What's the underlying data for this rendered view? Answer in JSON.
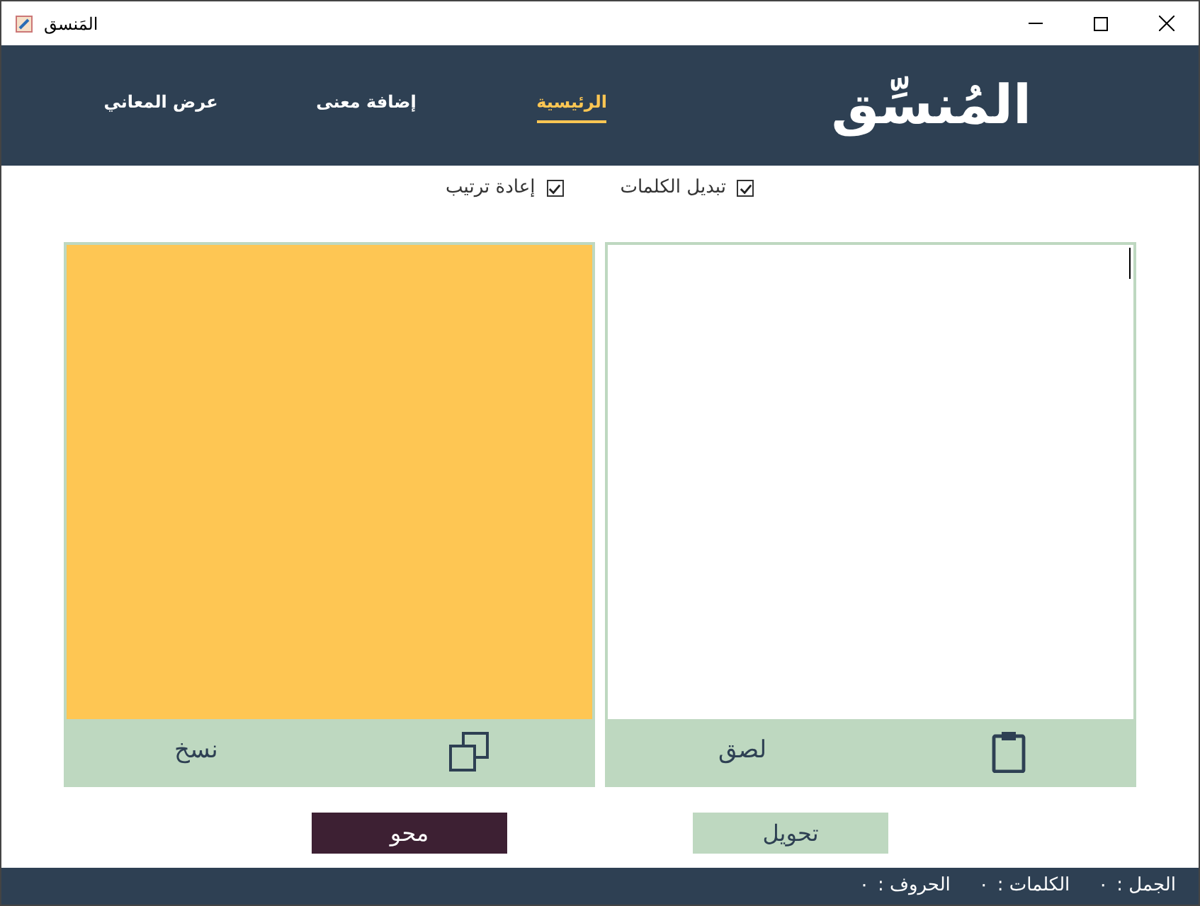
{
  "window": {
    "title": "المَنسق"
  },
  "header": {
    "logo": "المُنسِّق",
    "nav": [
      {
        "label": "الرئيسية",
        "selected": true
      },
      {
        "label": "إضافة معنى",
        "selected": false
      },
      {
        "label": "عرض المعاني",
        "selected": false
      }
    ]
  },
  "options": [
    {
      "label": "تبديل الكلمات",
      "checked": true
    },
    {
      "label": "إعادة ترتيب",
      "checked": true
    }
  ],
  "output_panel": {
    "copy_label": "نسخ"
  },
  "input_panel": {
    "paste_label": "لصق"
  },
  "buttons": [
    {
      "kind": "convert",
      "label": "تحويل"
    },
    {
      "kind": "clear",
      "label": "محو"
    }
  ],
  "status_bar": [
    {
      "label": "الجمل :",
      "value": "٠"
    },
    {
      "label": "الكلمات :",
      "value": "٠"
    },
    {
      "label": "الحروف :",
      "value": "٠"
    }
  ]
}
